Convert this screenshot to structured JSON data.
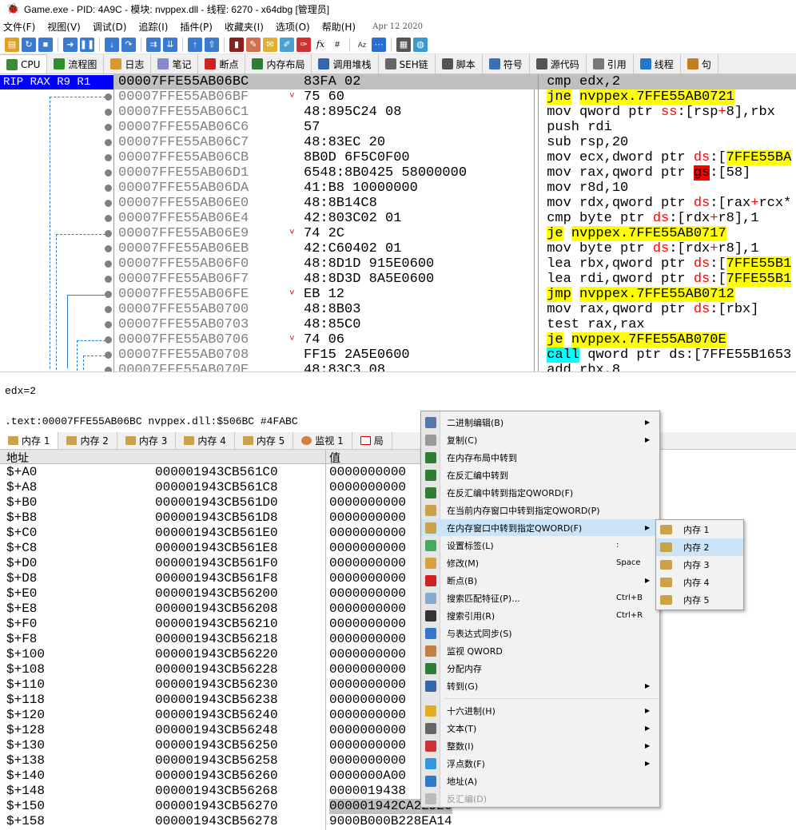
{
  "window": {
    "title": "Game.exe - PID: 4A9C - 模块: nvppex.dll - 线程: 6270 - x64dbg [管理员]"
  },
  "menu": {
    "items": [
      "文件(F)",
      "视图(V)",
      "调试(D)",
      "追踪(I)",
      "插件(P)",
      "收藏夹(I)",
      "选项(O)",
      "帮助(H)"
    ],
    "date": "Apr 12 2020"
  },
  "tabs": [
    {
      "label": "CPU",
      "color": "#3a8a3a"
    },
    {
      "label": "流程图",
      "color": "#2f8f2f"
    },
    {
      "label": "日志",
      "color": "#d89a30"
    },
    {
      "label": "笔记",
      "color": "#8888cc"
    },
    {
      "label": "断点",
      "color": "#cc2222"
    },
    {
      "label": "内存布局",
      "color": "#2e7d32"
    },
    {
      "label": "调用堆栈",
      "color": "#3366aa"
    },
    {
      "label": "SEH链",
      "color": "#666666"
    },
    {
      "label": "脚本",
      "color": "#555555"
    },
    {
      "label": "符号",
      "color": "#3b6fb6"
    },
    {
      "label": "源代码",
      "color": "#555555"
    },
    {
      "label": "引用",
      "color": "#777777"
    },
    {
      "label": "线程",
      "color": "#2277cc"
    },
    {
      "label": "句",
      "color": "#c08020"
    }
  ],
  "registers_label": "RIP RAX R9 R1",
  "disasm": [
    {
      "addr": "00007FFE55AB06BC",
      "bytes": "83FA 02",
      "arrow": "",
      "ins": "cmp edx,2",
      "sel": true
    },
    {
      "addr": "00007FFE55AB06BF",
      "bytes": "75 60",
      "arrow": "˅",
      "ins": "jne nvppex.7FFE55AB0721",
      "jmp": true
    },
    {
      "addr": "00007FFE55AB06C1",
      "bytes": "48:895C24 08",
      "arrow": "",
      "ins": "mov qword ptr ss:[rsp+8],rbx"
    },
    {
      "addr": "00007FFE55AB06C6",
      "bytes": "57",
      "arrow": "",
      "ins": "push rdi"
    },
    {
      "addr": "00007FFE55AB06C7",
      "bytes": "48:83EC 20",
      "arrow": "",
      "ins": "sub rsp,20"
    },
    {
      "addr": "00007FFE55AB06CB",
      "bytes": "8B0D 6F5C0F00",
      "arrow": "",
      "ins": "mov ecx,dword ptr ds:[7FFE55BA"
    },
    {
      "addr": "00007FFE55AB06D1",
      "bytes": "6548:8B0425 58000000",
      "arrow": "",
      "ins": "mov rax,qword ptr gs:[58]"
    },
    {
      "addr": "00007FFE55AB06DA",
      "bytes": "41:B8 10000000",
      "arrow": "",
      "ins": "mov r8d,10"
    },
    {
      "addr": "00007FFE55AB06E0",
      "bytes": "48:8B14C8",
      "arrow": "",
      "ins": "mov rdx,qword ptr ds:[rax+rcx*"
    },
    {
      "addr": "00007FFE55AB06E4",
      "bytes": "42:803C02 01",
      "arrow": "",
      "ins": "cmp byte ptr ds:[rdx+r8],1"
    },
    {
      "addr": "00007FFE55AB06E9",
      "bytes": "74 2C",
      "arrow": "˅",
      "ins": "je nvppex.7FFE55AB0717",
      "jmp": true
    },
    {
      "addr": "00007FFE55AB06EB",
      "bytes": "42:C60402 01",
      "arrow": "",
      "ins": "mov byte ptr ds:[rdx+r8],1"
    },
    {
      "addr": "00007FFE55AB06F0",
      "bytes": "48:8D1D 915E0600",
      "arrow": "",
      "ins": "lea rbx,qword ptr ds:[7FFE55B1"
    },
    {
      "addr": "00007FFE55AB06F7",
      "bytes": "48:8D3D 8A5E0600",
      "arrow": "",
      "ins": "lea rdi,qword ptr ds:[7FFE55B1"
    },
    {
      "addr": "00007FFE55AB06FE",
      "bytes": "EB 12",
      "arrow": "˅",
      "ins": "jmp nvppex.7FFE55AB0712",
      "jmp": true
    },
    {
      "addr": "00007FFE55AB0700",
      "bytes": "48:8B03",
      "arrow": "",
      "ins": "mov rax,qword ptr ds:[rbx]"
    },
    {
      "addr": "00007FFE55AB0703",
      "bytes": "48:85C0",
      "arrow": "",
      "ins": "test rax,rax"
    },
    {
      "addr": "00007FFE55AB0706",
      "bytes": "74 06",
      "arrow": "˅",
      "ins": "je nvppex.7FFE55AB070E",
      "jmp": true
    },
    {
      "addr": "00007FFE55AB0708",
      "bytes": "FF15 2A5E0600",
      "arrow": "",
      "ins": "call qword ptr ds:[7FFE55B1653",
      "call": true
    },
    {
      "addr": "00007FFE55AB070E",
      "bytes": "48:83C3 08",
      "arrow": "",
      "ins": "add rbx,8"
    }
  ],
  "info": {
    "line1": "edx=2",
    "line2": ".text:00007FFE55AB06BC nvppex.dll:$506BC #4FABC"
  },
  "memtabs": [
    "内存 1",
    "内存 2",
    "内存 3",
    "内存 4",
    "内存 5",
    "监视 1",
    "局"
  ],
  "dump_header": {
    "off": "地址",
    "val": "值"
  },
  "dump": [
    {
      "off": "$+A0",
      "addr": "000001943CB561C0",
      "val": "0000000000"
    },
    {
      "off": "$+A8",
      "addr": "000001943CB561C8",
      "val": "0000000000"
    },
    {
      "off": "$+B0",
      "addr": "000001943CB561D0",
      "val": "0000000000"
    },
    {
      "off": "$+B8",
      "addr": "000001943CB561D8",
      "val": "0000000000"
    },
    {
      "off": "$+C0",
      "addr": "000001943CB561E0",
      "val": "0000000000"
    },
    {
      "off": "$+C8",
      "addr": "000001943CB561E8",
      "val": "0000000000"
    },
    {
      "off": "$+D0",
      "addr": "000001943CB561F0",
      "val": "0000000000"
    },
    {
      "off": "$+D8",
      "addr": "000001943CB561F8",
      "val": "0000000000"
    },
    {
      "off": "$+E0",
      "addr": "000001943CB56200",
      "val": "0000000000"
    },
    {
      "off": "$+E8",
      "addr": "000001943CB56208",
      "val": "0000000000"
    },
    {
      "off": "$+F0",
      "addr": "000001943CB56210",
      "val": "0000000000"
    },
    {
      "off": "$+F8",
      "addr": "000001943CB56218",
      "val": "0000000000"
    },
    {
      "off": "$+100",
      "addr": "000001943CB56220",
      "val": "0000000000"
    },
    {
      "off": "$+108",
      "addr": "000001943CB56228",
      "val": "0000000000"
    },
    {
      "off": "$+110",
      "addr": "000001943CB56230",
      "val": "0000000000"
    },
    {
      "off": "$+118",
      "addr": "000001943CB56238",
      "val": "0000000000"
    },
    {
      "off": "$+120",
      "addr": "000001943CB56240",
      "val": "0000000000"
    },
    {
      "off": "$+128",
      "addr": "000001943CB56248",
      "val": "0000000000"
    },
    {
      "off": "$+130",
      "addr": "000001943CB56250",
      "val": "0000000000"
    },
    {
      "off": "$+138",
      "addr": "000001943CB56258",
      "val": "0000000000"
    },
    {
      "off": "$+140",
      "addr": "000001943CB56260",
      "val": "0000000A00"
    },
    {
      "off": "$+148",
      "addr": "000001943CB56268",
      "val": "0000019438"
    },
    {
      "off": "$+150",
      "addr": "000001943CB56270",
      "val": "000001942CA22D20",
      "selected": true
    },
    {
      "off": "$+158",
      "addr": "000001943CB56278",
      "val": "9000B000B228EA14"
    }
  ],
  "context_menu": {
    "items": [
      {
        "label": "二进制编辑(B)",
        "submenu": true,
        "color": "#5577aa"
      },
      {
        "label": "复制(C)",
        "submenu": true,
        "color": "#999999"
      },
      {
        "label": "在内存布局中转到",
        "color": "#2e7d32"
      },
      {
        "label": "在反汇编中转到",
        "color": "#2e7d32"
      },
      {
        "label": "在反汇编中转到指定QWORD(F)",
        "color": "#2e7d32"
      },
      {
        "label": "在当前内存窗口中转到指定QWORD(P)",
        "color": "#c9a24a"
      },
      {
        "label": "在内存窗口中转到指定QWORD(F)",
        "submenu": true,
        "highlight": true,
        "color": "#c9a24a"
      },
      {
        "label": "设置标签(L)",
        "shortcut": ":",
        "color": "#44aa66"
      },
      {
        "label": "修改(M)",
        "shortcut": "Space",
        "color": "#d9a040"
      },
      {
        "label": "断点(B)",
        "submenu": true,
        "color": "#cc2222"
      },
      {
        "label": "搜索匹配特征(P)...",
        "shortcut": "Ctrl+B",
        "color": "#88aacc"
      },
      {
        "label": "搜索引用(R)",
        "shortcut": "Ctrl+R",
        "color": "#333333"
      },
      {
        "label": "与表达式同步(S)",
        "color": "#3377cc"
      },
      {
        "label": "监视 QWORD",
        "color": "#c08040"
      },
      {
        "label": "分配内存",
        "color": "#2e7d32"
      },
      {
        "label": "转到(G)",
        "submenu": true,
        "color": "#3366aa"
      },
      {
        "label": "十六进制(H)",
        "submenu": true,
        "color": "#e0b020"
      },
      {
        "label": "文本(T)",
        "submenu": true,
        "color": "#666666"
      },
      {
        "label": "整数(I)",
        "submenu": true,
        "color": "#cc3333"
      },
      {
        "label": "浮点数(F)",
        "submenu": true,
        "color": "#3399dd"
      },
      {
        "label": "地址(A)",
        "color": "#3377cc"
      },
      {
        "label": "反汇编(D)",
        "disabled": true,
        "color": "#bbbbbb"
      }
    ]
  },
  "submenu": {
    "items": [
      "内存 1",
      "内存 2",
      "内存 3",
      "内存 4",
      "内存 5"
    ],
    "highlight_index": 1
  }
}
